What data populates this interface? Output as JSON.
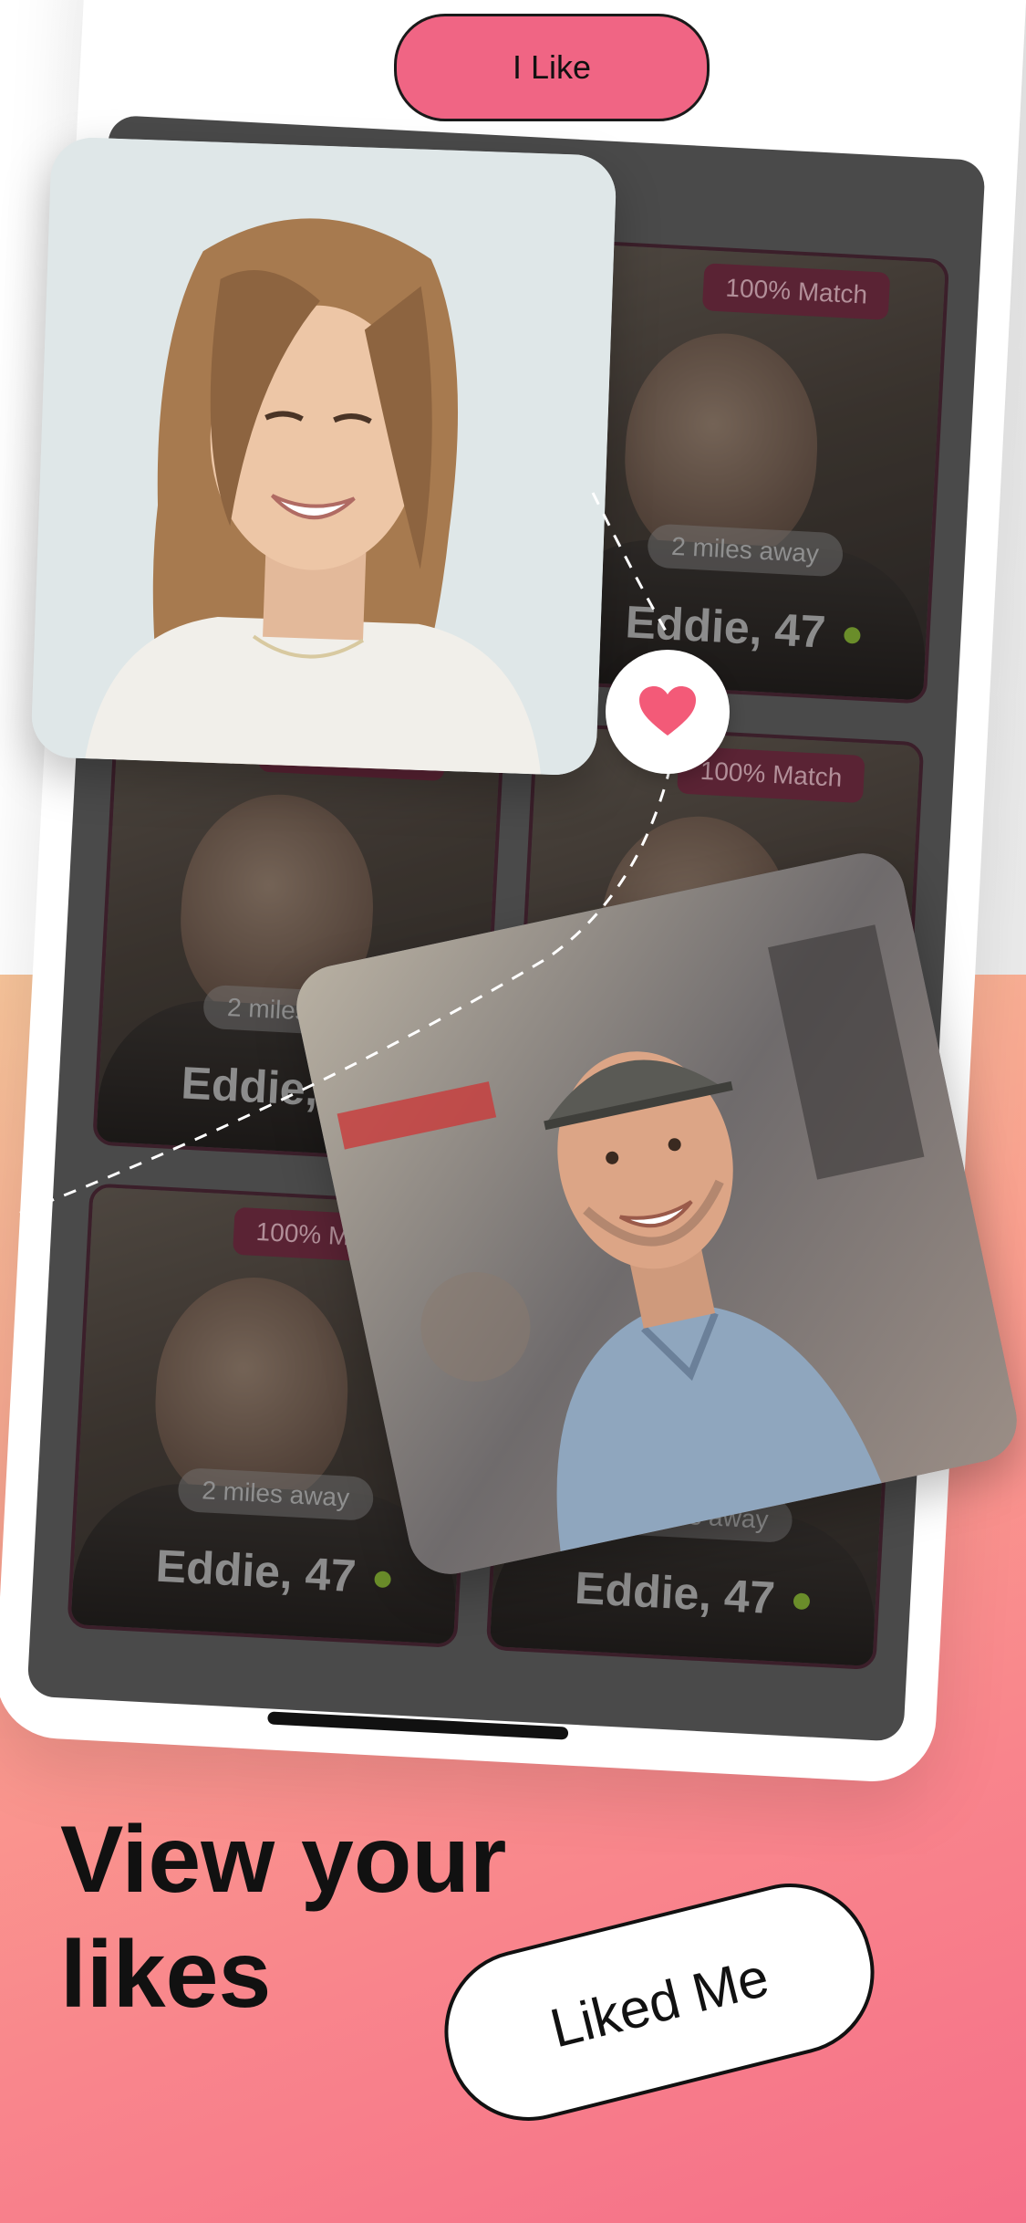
{
  "header": {
    "pill_label": "I Like"
  },
  "grid": {
    "tiles": [
      {
        "match": "100% Match",
        "distance": "2 miles away",
        "name": "Eddie, 47"
      },
      {
        "match": "100% Match",
        "distance": "2 miles away",
        "name": "Eddie, 47"
      },
      {
        "match": "100% Match",
        "distance": "",
        "name": ""
      },
      {
        "match": "100% Match",
        "distance": "2 miles away",
        "name": "Eddie, 47"
      },
      {
        "match": "",
        "distance": "2 miles away",
        "name": "Eddie, 47"
      }
    ]
  },
  "heading": "View your likes",
  "liked_me_label": "Liked Me",
  "icons": {
    "heart": "heart-icon"
  },
  "colors": {
    "accent": "#f06584",
    "heart": "#f35a78",
    "text": "#111111"
  }
}
